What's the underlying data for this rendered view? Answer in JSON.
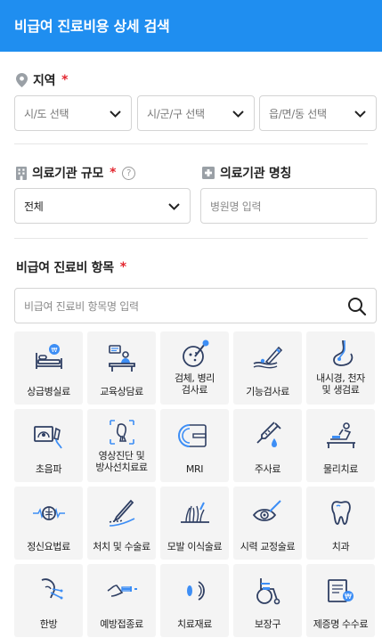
{
  "header": {
    "title": "비급여 진료비용 상세 검색"
  },
  "region": {
    "label": "지역",
    "required": "*",
    "sido_placeholder": "시/도 선택",
    "sigungu_placeholder": "시/군/구 선택",
    "eupmyeondong_placeholder": "읍/면/동 선택"
  },
  "scale": {
    "label": "의료기관 규모",
    "required": "*",
    "help": "?",
    "selected": "전체"
  },
  "name": {
    "label": "의료기관 명칭",
    "placeholder": "병원명 입력"
  },
  "items": {
    "label": "비급여 진료비 항목",
    "required": "*",
    "search_placeholder": "비급여 진료비 항목명 입력",
    "categories": [
      {
        "label": "상급병실료",
        "icon": "hospital-bed-icon"
      },
      {
        "label": "교육상담료",
        "icon": "consultation-desk-icon"
      },
      {
        "label": "검체, 병리\n검사료",
        "icon": "specimen-test-icon"
      },
      {
        "label": "기능검사료",
        "icon": "function-test-icon"
      },
      {
        "label": "내시경, 천자\n및 생검료",
        "icon": "endoscope-icon"
      },
      {
        "label": "초음파",
        "icon": "ultrasound-icon"
      },
      {
        "label": "영상진단 및\n방사선치료료",
        "icon": "radiology-icon"
      },
      {
        "label": "MRI",
        "icon": "mri-icon"
      },
      {
        "label": "주사료",
        "icon": "syringe-icon"
      },
      {
        "label": "물리치료",
        "icon": "physical-therapy-icon"
      },
      {
        "label": "정신요법료",
        "icon": "brain-wave-icon"
      },
      {
        "label": "처치 및 수술료",
        "icon": "surgery-icon"
      },
      {
        "label": "모발 이식술료",
        "icon": "hair-transplant-icon"
      },
      {
        "label": "시력 교정술료",
        "icon": "eye-laser-icon"
      },
      {
        "label": "치과",
        "icon": "tooth-icon"
      },
      {
        "label": "한방",
        "icon": "acupuncture-icon"
      },
      {
        "label": "예방접종료",
        "icon": "vaccination-icon"
      },
      {
        "label": "치료재료",
        "icon": "medical-material-icon"
      },
      {
        "label": "보장구",
        "icon": "wheelchair-icon"
      },
      {
        "label": "제증명 수수료",
        "icon": "certificate-icon"
      }
    ]
  },
  "colors": {
    "header_bg": "#1f8ef0",
    "icon_navy": "#2f3f63",
    "icon_blue": "#3d8ef5",
    "required": "#e3262f"
  }
}
